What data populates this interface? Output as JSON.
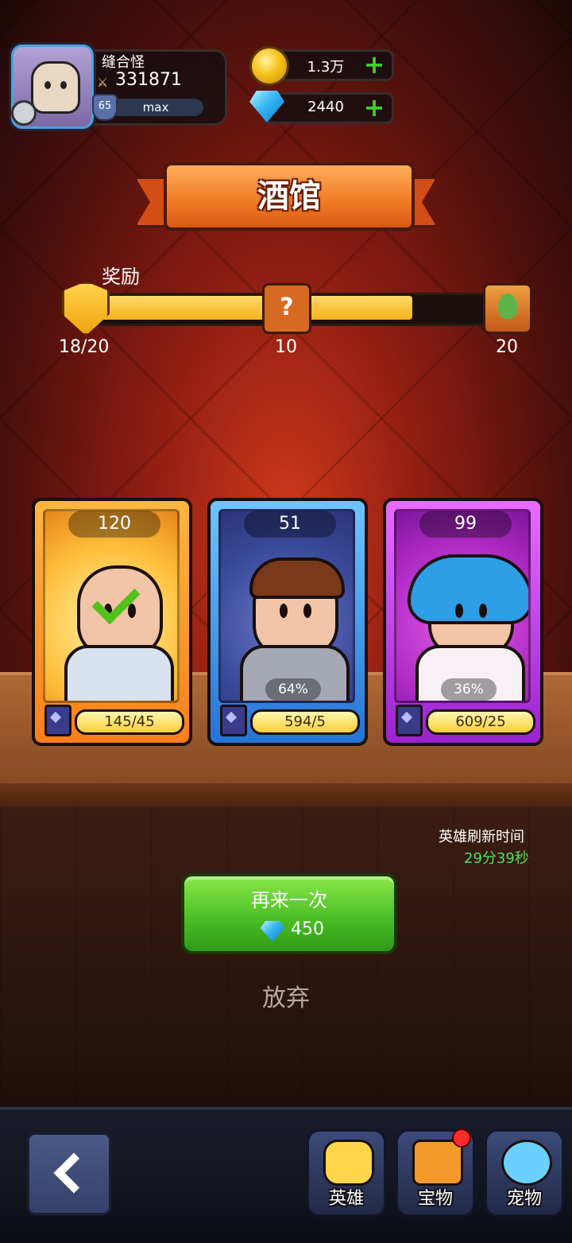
{
  "player": {
    "name": "缝合怪",
    "power": "331871",
    "level": "65",
    "xp_label": "max"
  },
  "currency": {
    "gold": "1.3万",
    "gems": "2440"
  },
  "banner": {
    "title": "酒馆"
  },
  "reward": {
    "label": "奖励",
    "progress": "18/20",
    "progress_fraction": 0.9,
    "milestone_1": "10",
    "milestone_2": "20"
  },
  "cards": [
    {
      "rarity_color": "#ff8a1a",
      "count": "120",
      "shards": "145/45",
      "selected": true
    },
    {
      "rarity_color": "#2f7fe0",
      "count": "51",
      "shards": "594/5",
      "percent": "64%"
    },
    {
      "rarity_color": "#b12bd6",
      "count": "99",
      "shards": "609/25",
      "percent": "36%"
    }
  ],
  "refresh": {
    "label": "英雄刷新时间",
    "time": "29分39秒"
  },
  "again_button": {
    "label": "再来一次",
    "cost": "450"
  },
  "give_up": "放弃",
  "nav": {
    "hero": "英雄",
    "treasure": "宝物",
    "pet": "宠物"
  }
}
